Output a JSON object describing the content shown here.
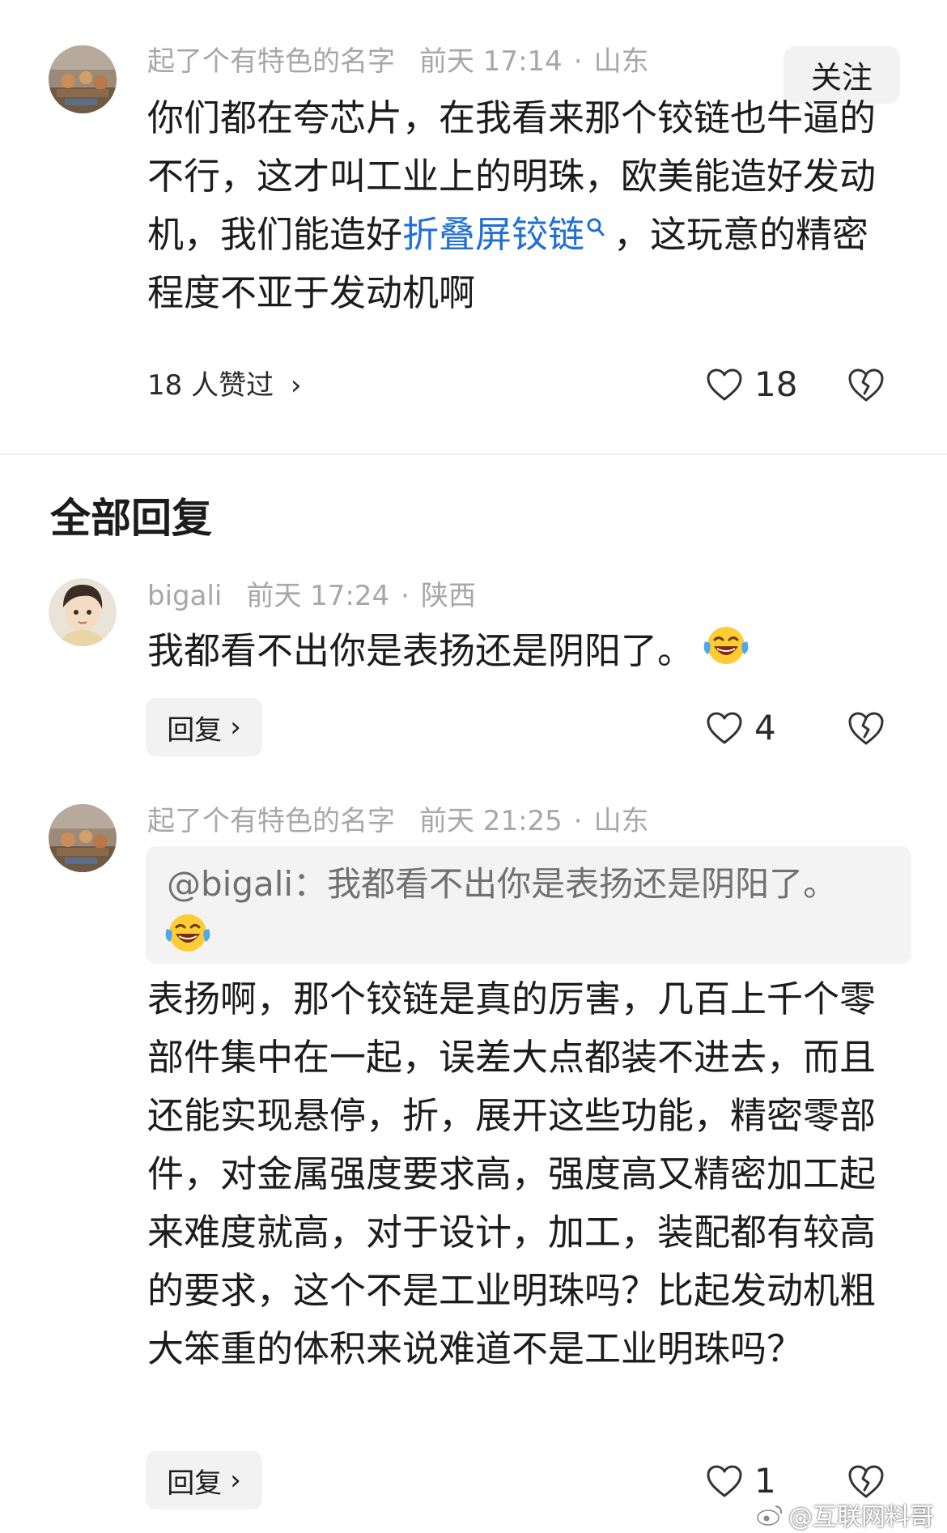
{
  "comment": {
    "author": "起了个有特色的名字",
    "time": "前天 17:14",
    "separator": "·",
    "location": "山东",
    "follow_label": "关注",
    "text_before_link": "你们都在夸芯片，在我看来那个铰链也牛逼的不行，这才叫工业上的明珠，欧美能造好发动机，我们能造好",
    "link_text": "折叠屏铰链",
    "text_after_link": "，这玩意的精密程度不亚于发动机啊",
    "liked_by": "18 人赞过",
    "liked_by_chevron": "›",
    "like_count": "18"
  },
  "replies_section": {
    "title": "全部回复"
  },
  "replies": [
    {
      "author": "bigali",
      "time": "前天 17:24",
      "separator": "·",
      "location": "陕西",
      "text": "我都看不出你是表扬还是阴阳了。",
      "reply_label": "回复",
      "reply_chevron": "›",
      "like_count": "4"
    },
    {
      "author": "起了个有特色的名字",
      "time": "前天 21:25",
      "separator": "·",
      "location": "山东",
      "quote": "@bigali：我都看不出你是表扬还是阴阳了。",
      "text": "表扬啊，那个铰链是真的厉害，几百上千个零部件集中在一起，误差大点都装不进去，而且还能实现悬停，折，展开这些功能，精密零部件，对金属强度要求高，强度高又精密加工起来难度就高，对于设计，加工，装配都有较高的要求，这个不是工业明珠吗？比起发动机粗大笨重的体积来说难道不是工业明珠吗？",
      "reply_label": "回复",
      "reply_chevron": "›",
      "like_count": "1"
    }
  ],
  "watermark": "@互联网料哥",
  "icons": {
    "like": "heart-outline-icon",
    "dislike": "broken-heart-icon",
    "search": "search-icon",
    "emoji": "laughing-tears-emoji",
    "weibo": "weibo-logo-icon"
  },
  "colors": {
    "link": "#1f6fd6",
    "meta": "#a7a7a7",
    "button_bg": "#f2f2f2",
    "quote_bg": "#f3f3f3"
  }
}
